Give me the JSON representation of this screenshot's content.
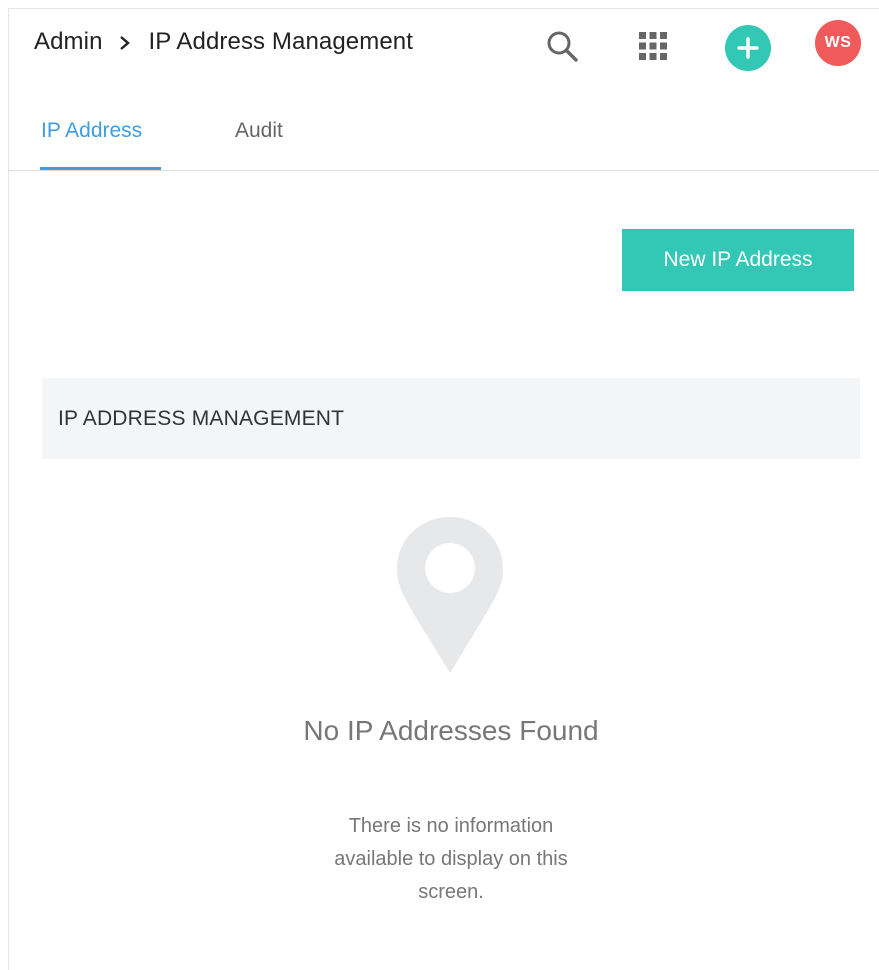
{
  "header": {
    "breadcrumb": [
      "Admin",
      "IP Address Management"
    ],
    "avatar_initials": "WS",
    "icons": [
      "search-icon",
      "apps-grid-icon",
      "plus-icon",
      "chevron-right-icon"
    ]
  },
  "tabs": [
    {
      "label": "IP Address",
      "active": true
    },
    {
      "label": "Audit",
      "active": false
    }
  ],
  "actions": {
    "new_ip_label": "New IP Address"
  },
  "panel": {
    "title": "IP ADDRESS MANAGEMENT"
  },
  "empty_state": {
    "icon": "map-pin-icon",
    "title": "No IP Addresses Found",
    "description": "There is no information available to display on this screen."
  },
  "colors": {
    "accent": "#33c7b5",
    "tab_active": "#3d9de0",
    "avatar": "#f05a5a",
    "panel_bg": "#f3f5f7"
  }
}
